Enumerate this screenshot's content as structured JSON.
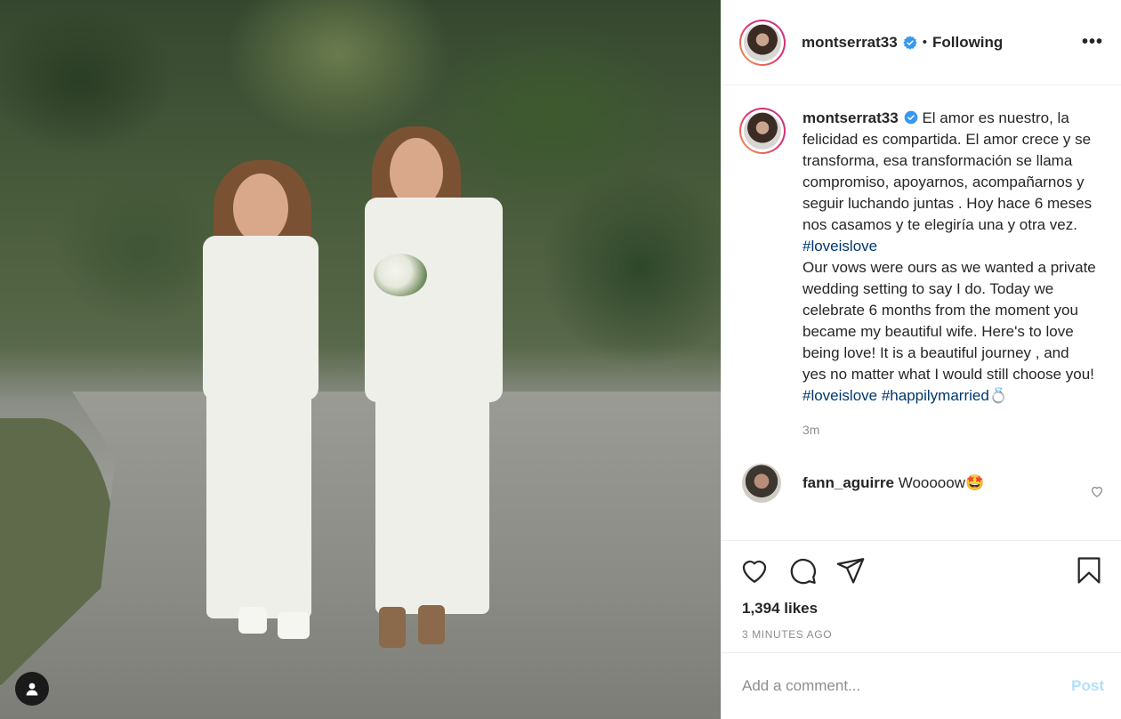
{
  "post": {
    "username": "montserrat33",
    "separator": "•",
    "follow_status": "Following",
    "more_label": "•••",
    "caption": {
      "username": "montserrat33",
      "text_es": " El amor es nuestro, la felicidad es compartida. El amor crece y se transforma, esa transformación se llama compromiso, apoyarnos, acompañarnos y seguir luchando juntas . Hoy hace 6 meses nos casamos y te elegiría una y otra vez.",
      "hashtag_1": "#loveislove",
      "text_en": "Our vows were ours as we wanted a private wedding setting to say I do. Today we celebrate 6 months from the moment you became my beautiful wife. Here's to love being love! It is a beautiful journey , and yes no matter what I would still choose you!",
      "hashtag_2": "#loveislove",
      "hashtag_3": "#happilymarried",
      "emoji_end": "💍"
    },
    "caption_time": "3m",
    "comments": [
      {
        "username": "fann_aguirre",
        "text": " Wooooow",
        "emoji": "🤩"
      }
    ],
    "likes": "1,394 likes",
    "posted_ago": "3 MINUTES AGO",
    "add_comment_placeholder": "Add a comment...",
    "post_button": "Post"
  },
  "icons": {
    "verified": "verified-badge-icon",
    "like": "heart-icon",
    "comment": "comment-icon",
    "share": "share-icon",
    "save": "bookmark-icon",
    "tagged_user": "user-icon"
  },
  "colors": {
    "verified": "#3897f0",
    "hashtag": "#00376b",
    "post_disabled": "#b2dffc",
    "muted_text": "#8e8e8e"
  }
}
